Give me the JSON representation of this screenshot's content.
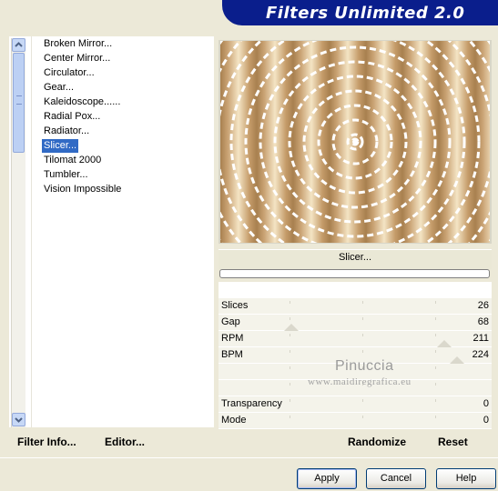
{
  "title": "Filters Unlimited 2.0",
  "filter_list": [
    {
      "label": "Broken Mirror...",
      "selected": false
    },
    {
      "label": "Center Mirror...",
      "selected": false
    },
    {
      "label": "Circulator...",
      "selected": false
    },
    {
      "label": "Gear...",
      "selected": false
    },
    {
      "label": "Kaleidoscope......",
      "selected": false
    },
    {
      "label": "Radial Pox...",
      "selected": false
    },
    {
      "label": "Radiator...",
      "selected": false
    },
    {
      "label": "Slicer...",
      "selected": true
    },
    {
      "label": "Tilomat 2000",
      "selected": false
    },
    {
      "label": "Tumbler...",
      "selected": false
    },
    {
      "label": "Vision Impossible",
      "selected": false
    }
  ],
  "left_buttons": {
    "filter_info": "Filter Info...",
    "editor": "Editor..."
  },
  "filter_name": "Slicer...",
  "params": [
    {
      "label": "Slices",
      "value": "26"
    },
    {
      "label": "Gap",
      "value": "68"
    },
    {
      "label": "RPM",
      "value": "211"
    },
    {
      "label": "BPM",
      "value": "224"
    },
    {
      "label": "",
      "value": ""
    },
    {
      "label": "",
      "value": ""
    },
    {
      "label": "Transparency",
      "value": "0"
    },
    {
      "label": "Mode",
      "value": "0"
    }
  ],
  "watermark": {
    "name": "Pinuccia",
    "url": "www.maidiregrafica.eu"
  },
  "right_buttons": {
    "randomize": "Randomize",
    "reset": "Reset"
  },
  "dialog_buttons": {
    "apply": "Apply",
    "cancel": "Cancel",
    "help": "Help"
  },
  "colors": {
    "banner": "#0a1e8c",
    "selection": "#316ac5",
    "preview_dark": "#a8804f",
    "preview_light": "#f4e4c4"
  },
  "icons": {
    "scroll_up": "chevron-up-icon",
    "scroll_down": "chevron-down-icon"
  }
}
